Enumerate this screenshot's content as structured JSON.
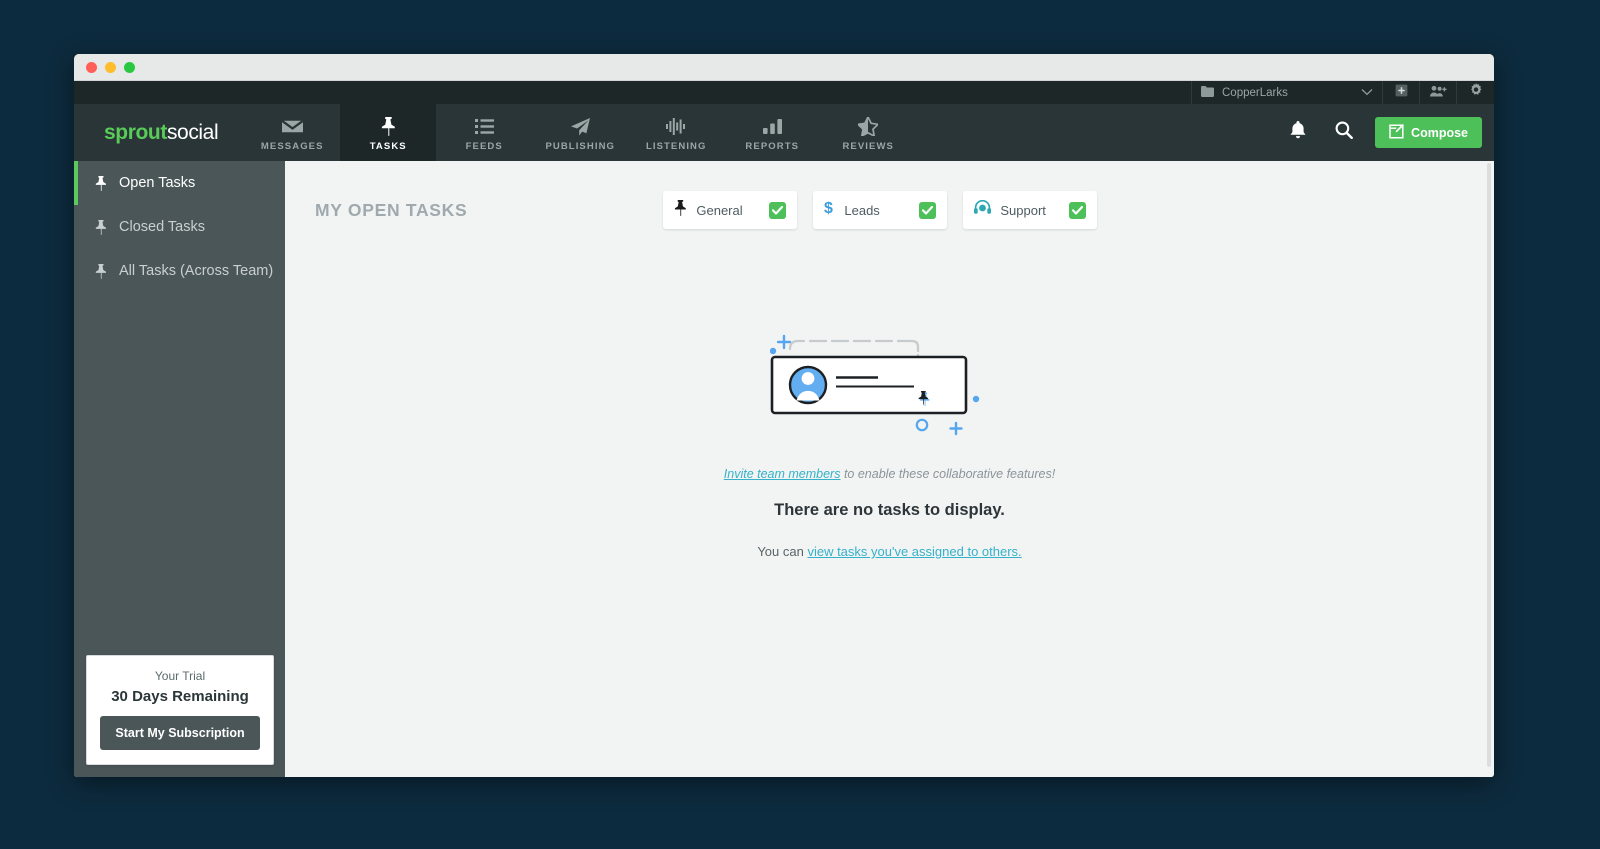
{
  "window": {
    "traffic_lights": [
      "close",
      "minimize",
      "maximize"
    ]
  },
  "topstrip": {
    "account": {
      "icon": "folder-icon",
      "label": "CopperLarks",
      "chevron": "chevron-down-icon"
    },
    "buttons": [
      {
        "name": "add-profile-button",
        "icon": "plus-square-icon"
      },
      {
        "name": "add-user-button",
        "icon": "user-add-icon"
      },
      {
        "name": "settings-button",
        "icon": "gear-icon"
      }
    ]
  },
  "nav": {
    "logo": {
      "part1": "sprout",
      "part2": "social"
    },
    "items": [
      {
        "label": "MESSAGES",
        "icon": "envelope-icon",
        "active": false
      },
      {
        "label": "TASKS",
        "icon": "pin-icon",
        "active": true
      },
      {
        "label": "FEEDS",
        "icon": "list-icon",
        "active": false
      },
      {
        "label": "PUBLISHING",
        "icon": "paper-plane-icon",
        "active": false
      },
      {
        "label": "LISTENING",
        "icon": "waveform-icon",
        "active": false
      },
      {
        "label": "REPORTS",
        "icon": "bar-chart-icon",
        "active": false
      },
      {
        "label": "REVIEWS",
        "icon": "star-icon",
        "active": false
      }
    ],
    "right": {
      "notifications_icon": "bell-icon",
      "search_icon": "search-icon",
      "compose_label": "Compose",
      "compose_icon": "compose-pencil-icon",
      "compose_color": "#4ec05a"
    }
  },
  "sidebar": {
    "items": [
      {
        "label": "Open Tasks",
        "icon": "pin-icon",
        "active": true
      },
      {
        "label": "Closed Tasks",
        "icon": "pin-icon",
        "active": false
      },
      {
        "label": "All Tasks (Across Team)",
        "icon": "pin-icon",
        "active": false
      }
    ],
    "active_indicator_color": "#5cc95c",
    "trial": {
      "label": "Your Trial",
      "value": "30 Days Remaining",
      "button_label": "Start My Subscription"
    }
  },
  "main": {
    "page_title": "MY OPEN TASKS",
    "filters": [
      {
        "label": "General",
        "icon": "pin-icon",
        "icon_color": "#1b1b1b",
        "checked": true
      },
      {
        "label": "Leads",
        "icon": "dollar-icon",
        "icon_color": "#3b9cdc",
        "checked": true
      },
      {
        "label": "Support",
        "icon": "headset-icon",
        "icon_color": "#2aa9b5",
        "checked": true
      }
    ],
    "check_color": "#4ec05a",
    "empty_state": {
      "illustration": "task-card-illustration",
      "invite_link": "Invite team members",
      "invite_rest": " to enable these collaborative features!",
      "title": "There are no tasks to display.",
      "sub_prefix": "You can ",
      "sub_link": "view tasks you've assigned to others.",
      "link_color": "#35b1c9"
    }
  }
}
